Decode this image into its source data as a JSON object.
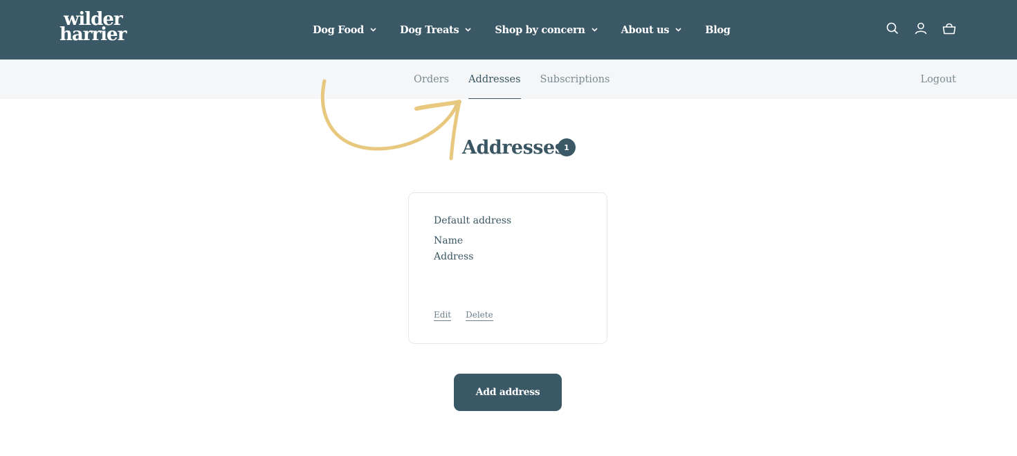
{
  "brand": {
    "line1": "wilder",
    "line2": "harrier"
  },
  "nav": {
    "items": [
      {
        "label": "Dog Food",
        "has_dropdown": true
      },
      {
        "label": "Dog Treats",
        "has_dropdown": true
      },
      {
        "label": "Shop by concern",
        "has_dropdown": true
      },
      {
        "label": "About us",
        "has_dropdown": true
      },
      {
        "label": "Blog",
        "has_dropdown": false
      }
    ],
    "icons": [
      "search-icon",
      "account-icon",
      "cart-icon"
    ]
  },
  "account_nav": {
    "tabs": [
      {
        "label": "Orders",
        "active": false
      },
      {
        "label": "Addresses",
        "active": true
      },
      {
        "label": "Subscriptions",
        "active": false
      }
    ],
    "logout_label": "Logout"
  },
  "page": {
    "title": "Addresses",
    "count": "1"
  },
  "address_card": {
    "heading": "Default address",
    "name": "Name",
    "address": "Address",
    "edit_label": "Edit",
    "delete_label": "Delete"
  },
  "add_address_label": "Add address",
  "colors": {
    "header_bg": "#3a5866",
    "subnav_bg": "#f5f6f7",
    "accent_arrow": "#e8c77e",
    "text": "#3a5663"
  }
}
